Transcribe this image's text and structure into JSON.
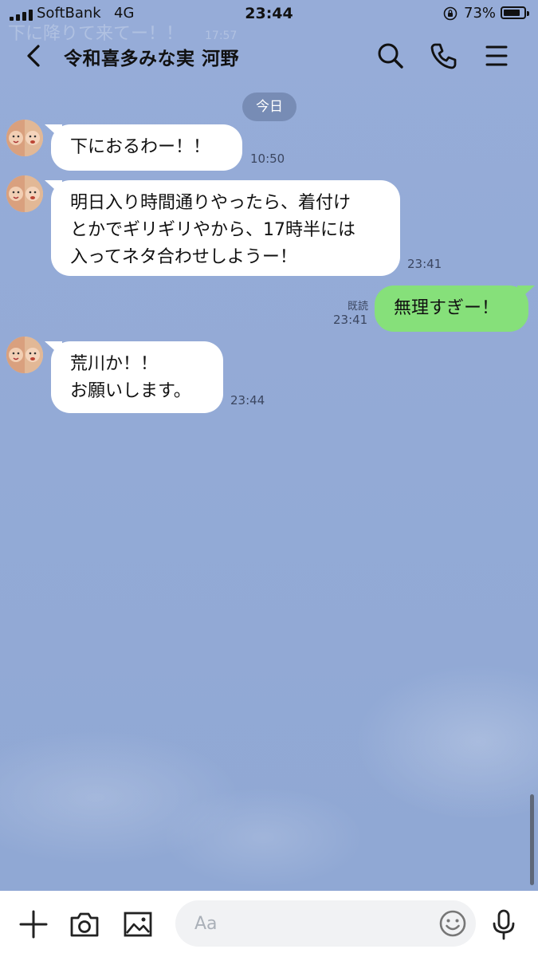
{
  "status_bar": {
    "carrier": "SoftBank",
    "network": "4G",
    "time": "23:44",
    "battery": "73%",
    "battery_level": 0.73
  },
  "header": {
    "ghost_text": "下に降りて来てー！！",
    "ghost_time": "17:57",
    "title": "令和喜多みな実 河野"
  },
  "date_chip": "今日",
  "messages": [
    {
      "side": "in",
      "text": "下におるわー！！",
      "time": "10:50"
    },
    {
      "side": "in",
      "text": "明日入り時間通りやったら、着付け\nとかでギリギリやから、17時半には\n入ってネタ合わせしようー！",
      "time": "23:41"
    },
    {
      "side": "out",
      "text": "無理すぎー！",
      "read": "既読",
      "time": "23:41"
    },
    {
      "side": "in",
      "text": "荒川か！！\nお願いします。",
      "time": "23:44"
    }
  ],
  "input": {
    "placeholder": "Aa",
    "value": ""
  },
  "icons": {
    "back": "chevron-left-icon",
    "search": "search-icon",
    "call": "phone-icon",
    "menu": "menu-icon",
    "add": "plus-icon",
    "camera": "camera-icon",
    "image": "image-icon",
    "emoji": "smile-icon",
    "voice": "microphone-icon"
  },
  "colors": {
    "background": "#8fa8d6",
    "incoming_bubble": "#ffffff",
    "outgoing_bubble": "#86e07a",
    "date_chip": "#6e82aa"
  }
}
